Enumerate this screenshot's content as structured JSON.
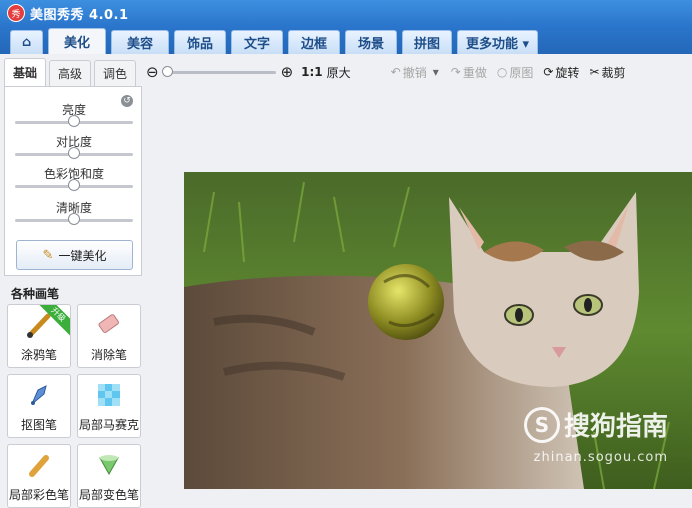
{
  "app": {
    "logo_glyph": "秀",
    "title": "美图秀秀 4.0.1"
  },
  "main_tabs": {
    "home_icon": "⌂",
    "items": [
      "美化",
      "美容",
      "饰品",
      "文字",
      "边框",
      "场景",
      "拼图"
    ],
    "more": "更多功能 ▾",
    "active": "美化"
  },
  "toolbar": {
    "zoom_out_icon": "⊖",
    "zoom_in_icon": "⊕",
    "zoom_level": 0.0,
    "ratio_label": "1:1",
    "original_size": "原大",
    "undo": "撤销",
    "undo_dropdown": "▾",
    "redo": "重做",
    "original": "原图",
    "rotate": "旋转",
    "crop": "裁剪"
  },
  "sub_tabs": {
    "items": [
      "基础",
      "高级",
      "调色"
    ],
    "active": "基础"
  },
  "adjust": {
    "sliders": [
      {
        "label": "亮度",
        "value": 0.5
      },
      {
        "label": "对比度",
        "value": 0.5
      },
      {
        "label": "色彩饱和度",
        "value": 0.5
      },
      {
        "label": "清晰度",
        "value": 0.5
      }
    ],
    "one_click": "一键美化"
  },
  "brushes": {
    "title": "各种画笔",
    "items": [
      {
        "label": "涂鸦笔",
        "icon": "paint-brush-icon",
        "ribbon": "升级"
      },
      {
        "label": "消除笔",
        "icon": "eraser-icon"
      },
      {
        "label": "抠图笔",
        "icon": "pen-tool-icon"
      },
      {
        "label": "局部马赛克",
        "icon": "mosaic-icon"
      },
      {
        "label": "局部彩色笔",
        "icon": "color-brush-icon"
      },
      {
        "label": "局部变色笔",
        "icon": "color-change-icon"
      }
    ]
  },
  "watermark": {
    "brand_glyph": "S",
    "brand": "搜狗指南",
    "url": "zhinan.sogou.com"
  }
}
